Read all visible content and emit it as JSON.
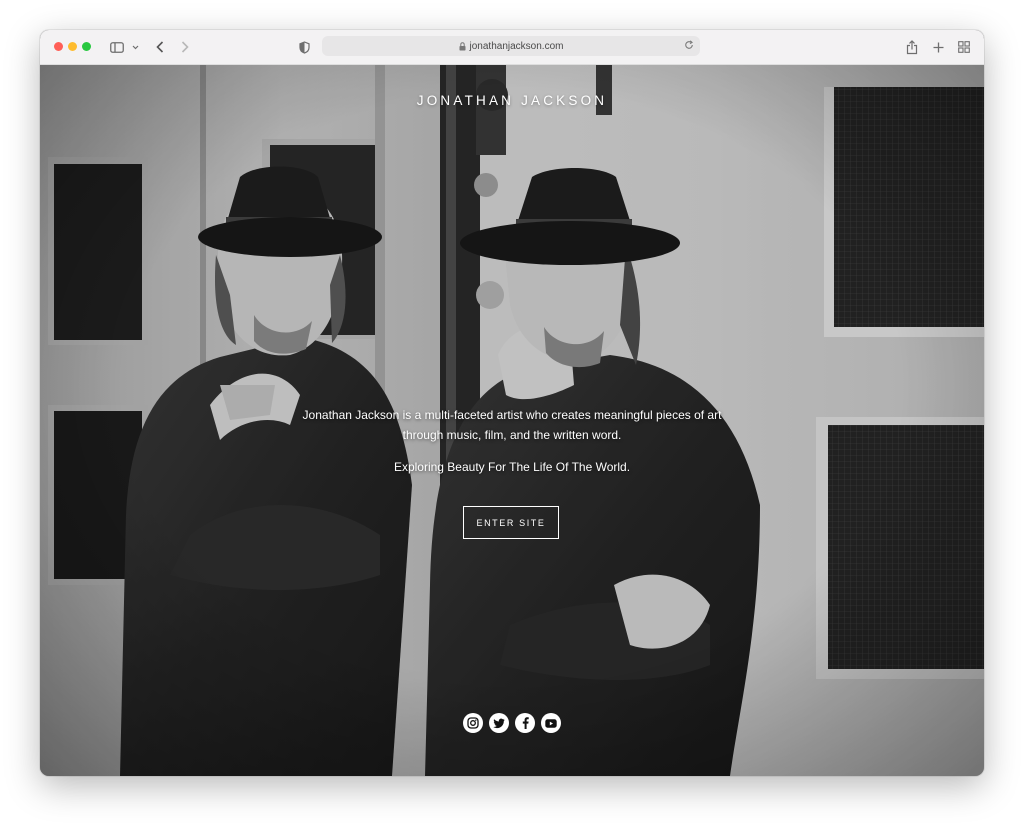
{
  "browser": {
    "url": "jonathanjackson.com",
    "icons": [
      "sidebar-icon",
      "chevron-down-icon",
      "back-icon",
      "forward-icon",
      "privacy-shield-icon",
      "lock-icon",
      "reload-icon",
      "share-icon",
      "new-tab-icon",
      "tab-overview-icon"
    ]
  },
  "site": {
    "title": "JONATHAN JACKSON",
    "tagline_line1": "Jonathan Jackson is a multi-faceted artist who creates meaningful pieces of art",
    "tagline_line2": "through music, film, and the written word.",
    "motto": "Exploring Beauty For The Life Of The World.",
    "enter_label": "ENTER SITE",
    "social": [
      "instagram-icon",
      "twitter-icon",
      "facebook-icon",
      "youtube-icon"
    ]
  },
  "colors": {
    "text": "#ffffff",
    "browser_chrome": "#f3f2f3"
  }
}
